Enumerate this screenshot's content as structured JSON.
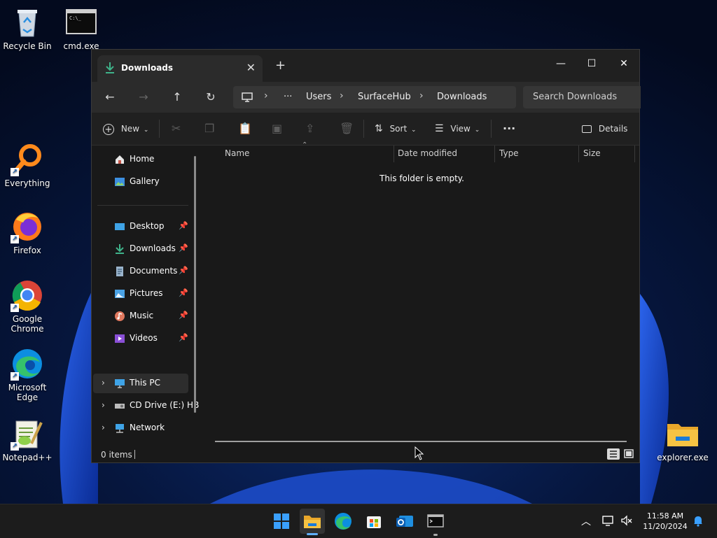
{
  "desktop": {
    "icons": [
      {
        "label": "Recycle Bin"
      },
      {
        "label": "cmd.exe"
      },
      {
        "label": "Everything"
      },
      {
        "label": "Firefox"
      },
      {
        "label": "Google Chrome"
      },
      {
        "label": "Microsoft Edge"
      },
      {
        "label": "Notepad++"
      },
      {
        "label": "explorer.exe"
      }
    ]
  },
  "window": {
    "tab_title": "Downloads",
    "close_glyph": "✕",
    "new_tab_glyph": "+",
    "controls": {
      "minimize": "—",
      "maximize": "☐",
      "close": "✕"
    },
    "breadcrumb": [
      "···",
      "Users",
      "SurfaceHub",
      "Downloads"
    ],
    "search_placeholder": "Search Downloads",
    "toolbar": {
      "new_label": "New",
      "sort_label": "Sort",
      "view_label": "View",
      "more_label": "···",
      "details_label": "Details"
    },
    "sidebar": {
      "items": [
        {
          "label": "Home"
        },
        {
          "label": "Gallery"
        },
        {
          "label": "Desktop"
        },
        {
          "label": "Downloads"
        },
        {
          "label": "Documents"
        },
        {
          "label": "Pictures"
        },
        {
          "label": "Music"
        },
        {
          "label": "Videos"
        },
        {
          "label": "This PC"
        },
        {
          "label": "CD Drive (E:) HB"
        },
        {
          "label": "Network"
        }
      ]
    },
    "columns": [
      "Name",
      "Date modified",
      "Type",
      "Size"
    ],
    "empty_message": "This folder is empty.",
    "status": "0 items"
  },
  "taskbar": {
    "time": "11:58 AM",
    "date": "11/20/2024"
  },
  "colors": {
    "accent": "#0067c0",
    "folder_yellow": "#f6c343",
    "download_green": "#3fb38a"
  }
}
